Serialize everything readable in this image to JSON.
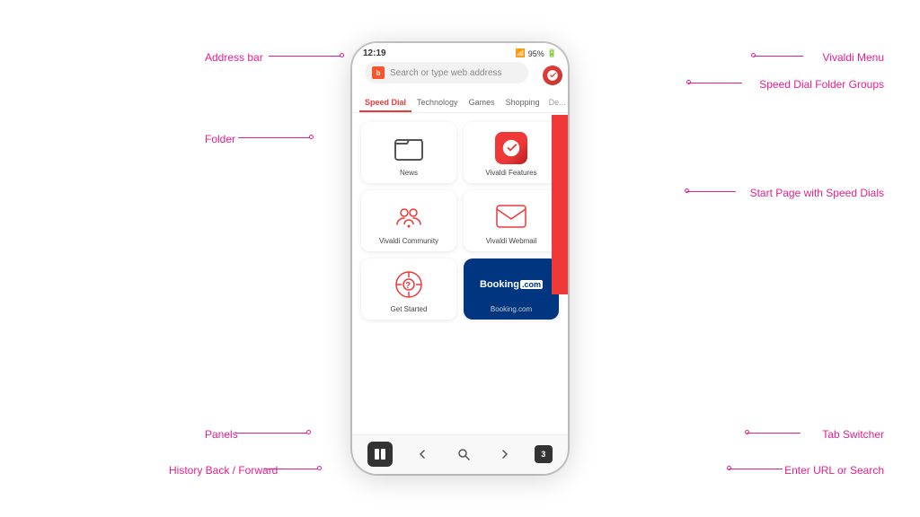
{
  "page": {
    "bg_color": "#ffffff"
  },
  "status_bar": {
    "time": "12:19",
    "signal": "95%",
    "battery_icon": "🔋"
  },
  "address_bar": {
    "placeholder": "Search or type web address",
    "brave_label": "b",
    "vivaldi_label": "V"
  },
  "tabs": [
    {
      "label": "Speed Dial",
      "active": true
    },
    {
      "label": "Technology",
      "active": false
    },
    {
      "label": "Games",
      "active": false
    },
    {
      "label": "Shopping",
      "active": false
    },
    {
      "label": "De...",
      "active": false
    }
  ],
  "speed_dials": [
    {
      "id": "news",
      "label": "News",
      "type": "folder"
    },
    {
      "id": "vivaldi-features",
      "label": "Vivaldi Features",
      "type": "vivaldi"
    },
    {
      "id": "community",
      "label": "Vivaldi Community",
      "type": "community"
    },
    {
      "id": "webmail",
      "label": "Vivaldi Webmail",
      "type": "webmail"
    },
    {
      "id": "get-started",
      "label": "Get Started",
      "type": "getstarted"
    },
    {
      "id": "booking",
      "label": "Booking.com",
      "type": "booking"
    }
  ],
  "bottom_nav": {
    "tab_count": "3"
  },
  "annotations": {
    "address_bar": "Address bar",
    "vivaldi_menu": "Vivaldi Menu",
    "speed_dial_folder_groups": "Speed Dial Folder Groups",
    "folder": "Folder",
    "start_page": "Start Page with Speed Dials",
    "panels": "Panels",
    "history": "History Back / Forward",
    "enter_url": "Enter URL or Search",
    "tab_switcher": "Tab Switcher"
  }
}
